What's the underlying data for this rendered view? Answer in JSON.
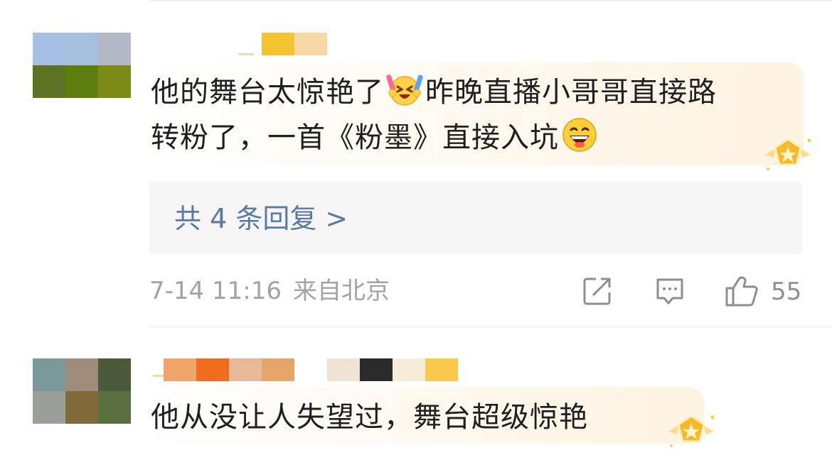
{
  "comments": [
    {
      "text_line1_a": "他的舞台太惊艳了",
      "emoji1": "cheering-emoji",
      "text_line1_b": "昨晚直播小哥哥直接路",
      "text_line2": "转粉了，一首《粉墨》直接入坑",
      "emoji2": "laughing-emoji",
      "reply_summary": "共 4 条回复 >",
      "date": "7-14 11:16",
      "location": "来自北京",
      "like_count": "55",
      "badge": "star-fan-badge",
      "avatar_colors": [
        "#a7bfe3",
        "#a8c0e0",
        "#b3b9c6",
        "#5e7223",
        "#5e7d0f",
        "#7e8a18"
      ],
      "username_colors": [
        "#f5c330",
        "#f6d7a6",
        "#ffffff"
      ]
    },
    {
      "text": "他从没让人失望过，舞台超级惊艳",
      "badge": "star-fan-badge",
      "avatar_colors": [
        "#7a9a9a",
        "#a08c7a",
        "#4a5a3a",
        "#9aa098",
        "#806a3a",
        "#5a7040"
      ],
      "username_colors": [
        "#f0a468",
        "#f06c1e",
        "#e9b896",
        "#e8a56a",
        "#ffffff",
        "#f2e4d4",
        "#2a2a2a",
        "#f6ecd8",
        "#f9c84c"
      ]
    }
  ],
  "icons": {
    "forward": "share-icon",
    "comment": "comment-icon",
    "like": "thumbs-up-icon"
  }
}
